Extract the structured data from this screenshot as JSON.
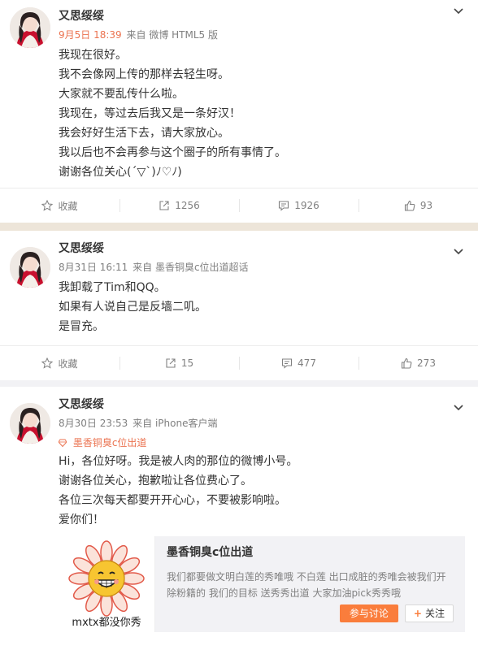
{
  "posts": [
    {
      "username": "又思绥绥",
      "date": "9月5日 18:39",
      "source": "来自 微博 HTML5 版",
      "lines": [
        "我现在很好。",
        "我不会像网上传的那样去轻生呀。",
        "大家就不要乱传什么啦。",
        "我现在，等过去后我又是一条好汉！",
        "我会好好生活下去，请大家放心。",
        "我以后也不会再参与这个圈子的所有事情了。",
        "谢谢各位关心(´▽`)ﾉ♡ﾉ)"
      ],
      "actions": {
        "favorite": "收藏",
        "repost": "1256",
        "comment": "1926",
        "like": "93"
      }
    },
    {
      "username": "又思绥绥",
      "date": "8月31日 16:11",
      "source": "来自 墨香铜臭c位出道超话",
      "lines": [
        "我卸载了Tim和QQ。",
        "如果有人说自己是反墙二叽。",
        "是冒充。"
      ],
      "actions": {
        "favorite": "收藏",
        "repost": "15",
        "comment": "477",
        "like": "273"
      }
    },
    {
      "username": "又思绥绥",
      "date": "8月30日 23:53",
      "source": "来自 iPhone客户端",
      "topic": "墨香铜臭c位出道",
      "lines": [
        "Hi，各位好呀。我是被人肉的那位的微博小号。",
        "谢谢各位关心，抱歉啦让各位费心了。",
        "各位三次每天都要开开心心，不要被影响啦。",
        "爱你们！"
      ],
      "card": {
        "title": "墨香铜臭c位出道",
        "desc": "我们都要做文明白莲的秀唯哦 不白莲 出口成脏的秀唯会被我们开除粉籍的 我们的目标 送秀秀出道 大家加油pick秀秀哦",
        "image_caption": "mxtx都没你秀",
        "join_label": "参与讨论",
        "follow_label": "关注"
      }
    }
  ],
  "colors": {
    "accent": "#eb7350",
    "button": "#fa7d3c",
    "text": "#333333",
    "muted": "#808080"
  }
}
